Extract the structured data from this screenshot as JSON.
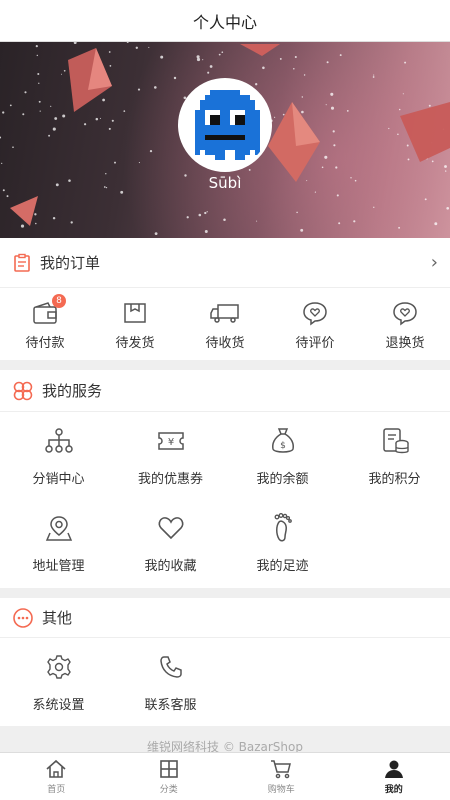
{
  "header": {
    "title": "个人中心"
  },
  "profile": {
    "username": "Sūbì"
  },
  "orders": {
    "title": "我的订单",
    "items": [
      {
        "label": "待付款",
        "badge": "8"
      },
      {
        "label": "待发货"
      },
      {
        "label": "待收货"
      },
      {
        "label": "待评价"
      },
      {
        "label": "退换货"
      }
    ]
  },
  "services": {
    "title": "我的服务",
    "items": [
      {
        "label": "分销中心"
      },
      {
        "label": "我的优惠券"
      },
      {
        "label": "我的余额"
      },
      {
        "label": "我的积分"
      },
      {
        "label": "地址管理"
      },
      {
        "label": "我的收藏"
      },
      {
        "label": "我的足迹"
      }
    ]
  },
  "other": {
    "title": "其他",
    "items": [
      {
        "label": "系统设置"
      },
      {
        "label": "联系客服"
      }
    ]
  },
  "footer": {
    "text": "维锐网络科技 © BazarShop"
  },
  "tabbar": {
    "items": [
      {
        "label": "首页"
      },
      {
        "label": "分类"
      },
      {
        "label": "购物车"
      },
      {
        "label": "我的"
      }
    ]
  },
  "colors": {
    "accent": "#f46a52",
    "banner_dark": "#2a2327",
    "banner_light": "#cf9aa2",
    "avatar_blue": "#1a72d8"
  }
}
